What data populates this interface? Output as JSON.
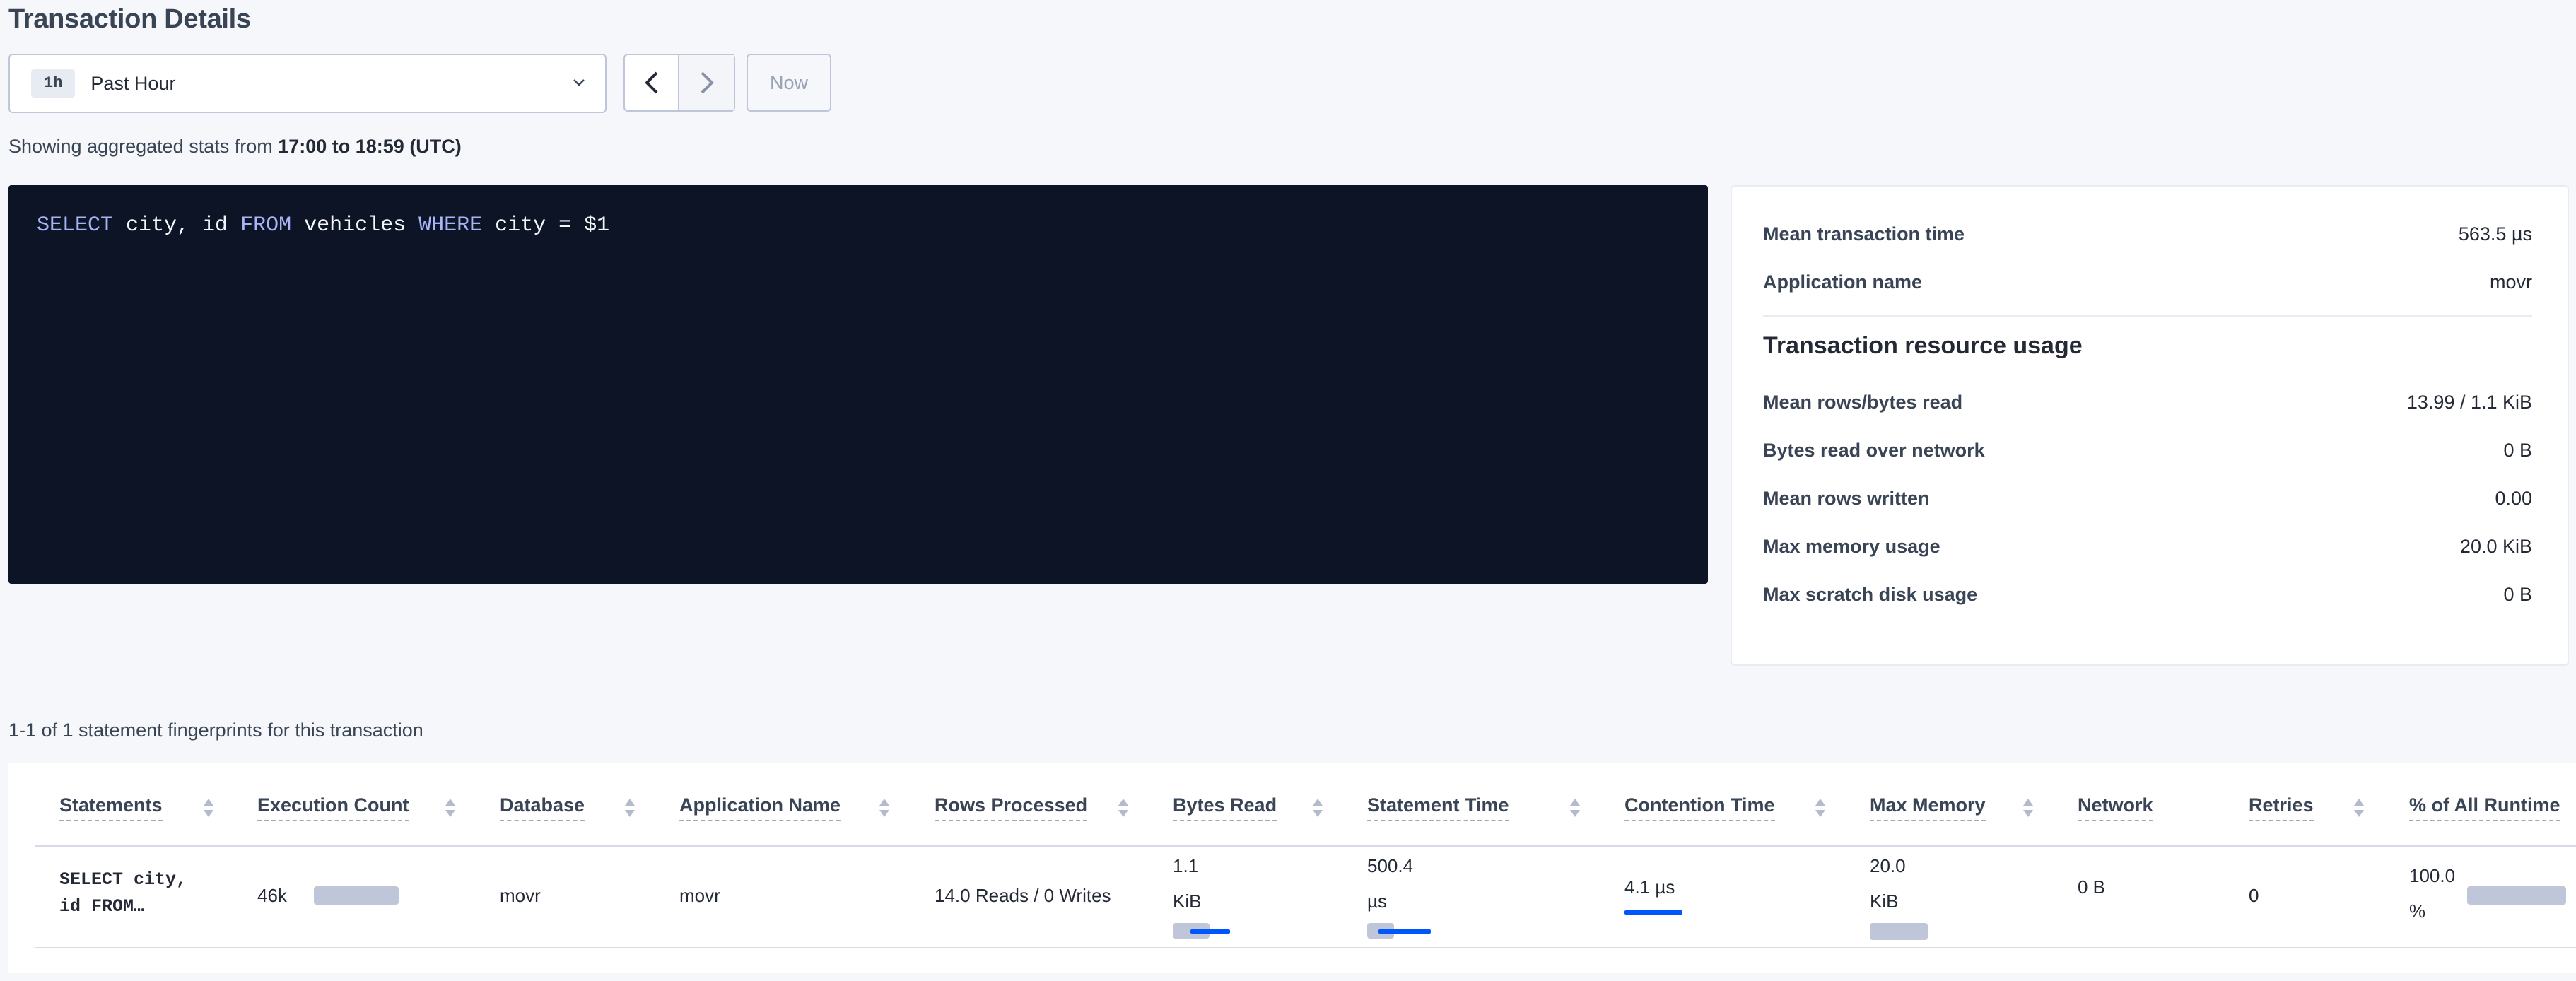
{
  "header": {
    "title": "Transaction Details",
    "time_select": {
      "pill": "1h",
      "label": "Past Hour"
    },
    "now_label": "Now",
    "stats_prefix": "Showing aggregated stats from ",
    "stats_range": "17:00 to 18:59 (UTC)"
  },
  "sql": {
    "tokens": [
      {
        "t": "SELECT",
        "kw": true
      },
      {
        "t": " city, id ",
        "kw": false
      },
      {
        "t": "FROM",
        "kw": true
      },
      {
        "t": " vehicles ",
        "kw": false
      },
      {
        "t": "WHERE",
        "kw": true
      },
      {
        "t": " city = $1",
        "kw": false
      }
    ]
  },
  "summary": {
    "mean_transaction_time": {
      "label": "Mean transaction time",
      "value": "563.5 µs"
    },
    "application_name": {
      "label": "Application name",
      "value": "movr"
    },
    "resource_title": "Transaction resource usage",
    "rows": [
      {
        "label": "Mean rows/bytes read",
        "value": "13.99 / 1.1 KiB"
      },
      {
        "label": "Bytes read over network",
        "value": "0 B"
      },
      {
        "label": "Mean rows written",
        "value": "0.00"
      },
      {
        "label": "Max memory usage",
        "value": "20.0 KiB"
      },
      {
        "label": "Max scratch disk usage",
        "value": "0 B"
      }
    ]
  },
  "fingerprints_text": "1-1 of 1 statement fingerprints for this transaction",
  "table": {
    "columns": [
      "Statements",
      "Execution Count",
      "Database",
      "Application Name",
      "Rows Processed",
      "Bytes Read",
      "Statement Time",
      "Contention Time",
      "Max Memory",
      "Network",
      "Retries",
      "% of All Runtime"
    ],
    "row": {
      "statement_line1": "SELECT city,",
      "statement_line2": "id FROM…",
      "execution_count": "46k",
      "database": "movr",
      "application_name": "movr",
      "rows_processed": "14.0 Reads / 0 Writes",
      "bytes_read_line1": "1.1",
      "bytes_read_line2": "KiB",
      "statement_time_line1": "500.4",
      "statement_time_line2": "µs",
      "contention_time": "4.1 µs",
      "max_memory_line1": "20.0",
      "max_memory_line2": "KiB",
      "network": "0 B",
      "retries": "0",
      "runtime_line1": "100.0",
      "runtime_line2": "%"
    }
  },
  "icons": {
    "chevron": "chevron-down-icon",
    "prev": "chevron-left-icon",
    "next": "chevron-right-icon",
    "sort": "sort-icon"
  },
  "colors": {
    "sql_bg": "#0d1425",
    "sql_keyword": "#a7b4f8",
    "bar_blue": "#0055ff",
    "bar_grey": "#c0c6d9"
  }
}
